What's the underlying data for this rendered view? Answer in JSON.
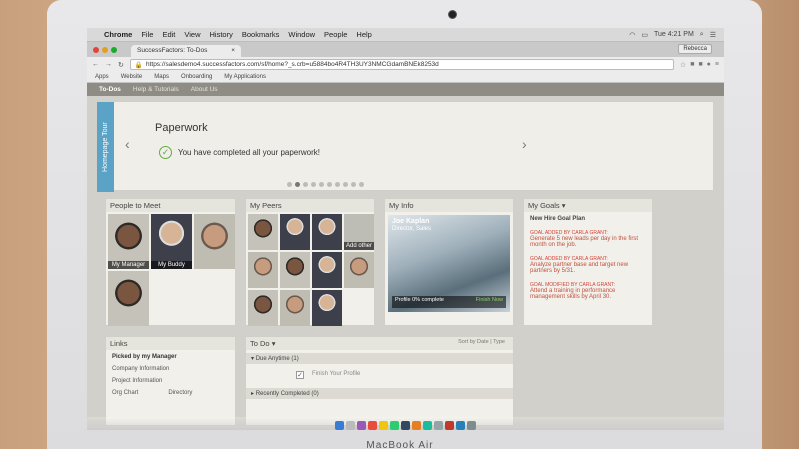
{
  "menubar": {
    "app": "Chrome",
    "items": [
      "File",
      "Edit",
      "View",
      "History",
      "Bookmarks",
      "Window",
      "People",
      "Help"
    ],
    "clock": "Tue 4:21 PM"
  },
  "tab": {
    "title": "SuccessFactors: To-Dos",
    "user": "Rebecca"
  },
  "address": {
    "url": "https://salesdemo4.successfactors.com/sf/home?_s.crb=u5884bo4R4TH3UY3NMCGdamBNEk8253d"
  },
  "bookmarks": [
    "Apps",
    "Website",
    "Maps",
    "Onboarding",
    "My Applications"
  ],
  "sfnav": {
    "items": [
      "To-Dos",
      "Help & Tutorials",
      "About Us"
    ]
  },
  "tour": {
    "tab_label": "Homepage Tour",
    "title": "Paperwork",
    "message": "You have completed all your paperwork!",
    "slides": 10,
    "current_slide": 2
  },
  "people_to_meet": {
    "title": "People to Meet",
    "people": [
      {
        "label": "My Manager"
      },
      {
        "label": "My Buddy"
      },
      {
        "label": ""
      },
      {
        "label": ""
      }
    ]
  },
  "my_peers": {
    "title": "My Peers",
    "add_label": "Add other"
  },
  "my_info": {
    "title": "My Info",
    "name": "Joe Kaplan",
    "role": "Director, Sales",
    "progress_text": "Profile 0% complete",
    "progress": 0,
    "action": "Finish Now"
  },
  "my_goals": {
    "title": "My Goals",
    "plan": "New Hire Goal Plan",
    "goals": [
      {
        "by": "GOAL ADDED BY CARLA GRANT:",
        "text": "Generate 5 new leads per day in the first month on the job."
      },
      {
        "by": "GOAL ADDED BY CARLA GRANT:",
        "text": "Analyze partner base and target new partners by 5/31."
      },
      {
        "by": "GOAL MODIFIED BY CARLA GRANT:",
        "text": "Attend a training in performance management skills by April 30."
      }
    ]
  },
  "links": {
    "title": "Links",
    "section": "Picked by my Manager",
    "items": [
      "Company Information",
      "Project Information",
      "Org Chart",
      "Directory"
    ]
  },
  "todo": {
    "title": "To Do",
    "sort": "Sort by Date | Type",
    "due_anytime": "Due Anytime (1)",
    "item": "Finish Your Profile",
    "recently_completed": "Recently Completed (0)"
  },
  "brand": "MacBook Air"
}
